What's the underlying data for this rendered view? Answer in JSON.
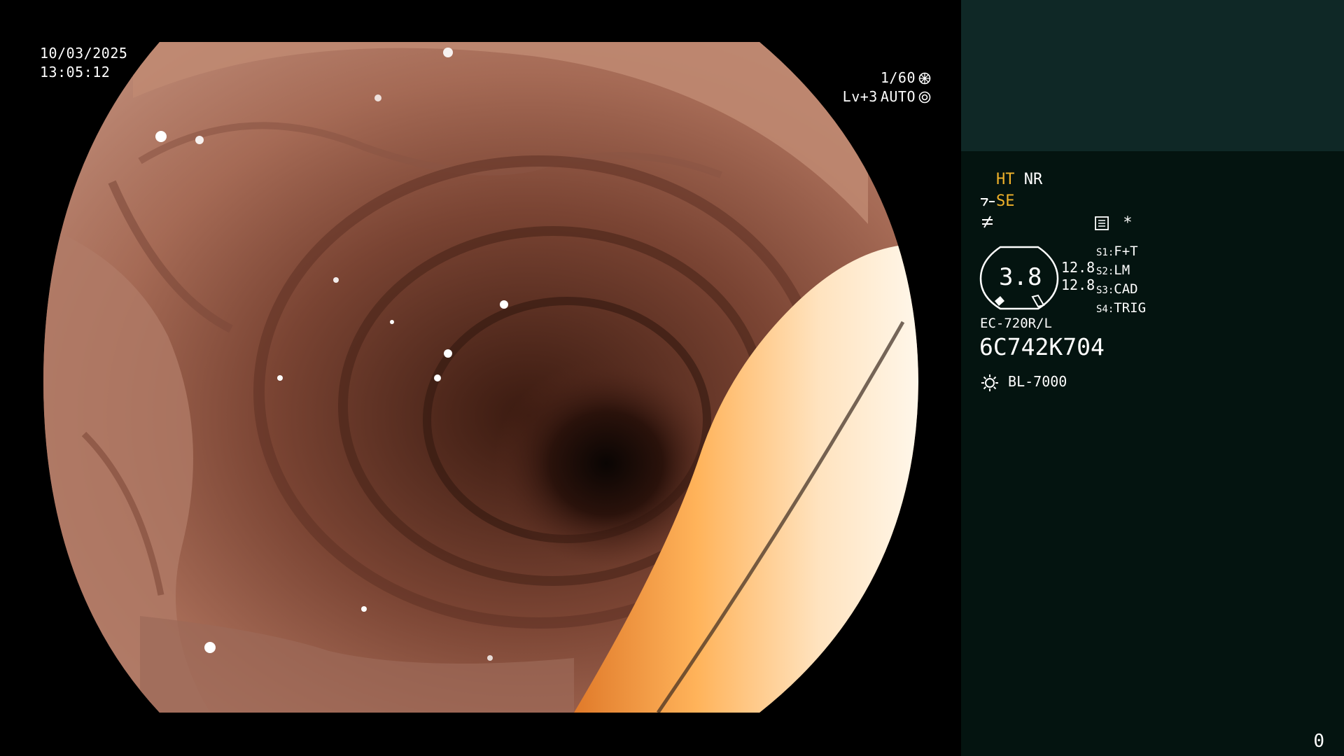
{
  "osd": {
    "date": "10/03/2025",
    "time": "13:05:12",
    "shutter": "1/60",
    "level": "Lv+3",
    "iris_mode": "AUTO"
  },
  "panel": {
    "mode_ht": "HT",
    "mode_nr": "NR",
    "mode_se": "SE",
    "asterisk": "*",
    "zoom_value": "3.8",
    "zoom_side_1": "12.8",
    "zoom_side_2": "12.8",
    "switches": [
      {
        "key": "S1:",
        "value": "F+T"
      },
      {
        "key": "S2:",
        "value": "LM"
      },
      {
        "key": "S3:",
        "value": "CAD"
      },
      {
        "key": "S4:",
        "value": "TRIG"
      }
    ],
    "scope_model": "EC-720R/L",
    "scope_serial": "6C742K704",
    "light_source": "BL-7000",
    "frame_counter": "0"
  },
  "colors": {
    "panel_bg": "#041410",
    "panel_top": "#0f2826",
    "mode_amber": "#f0b22a"
  }
}
